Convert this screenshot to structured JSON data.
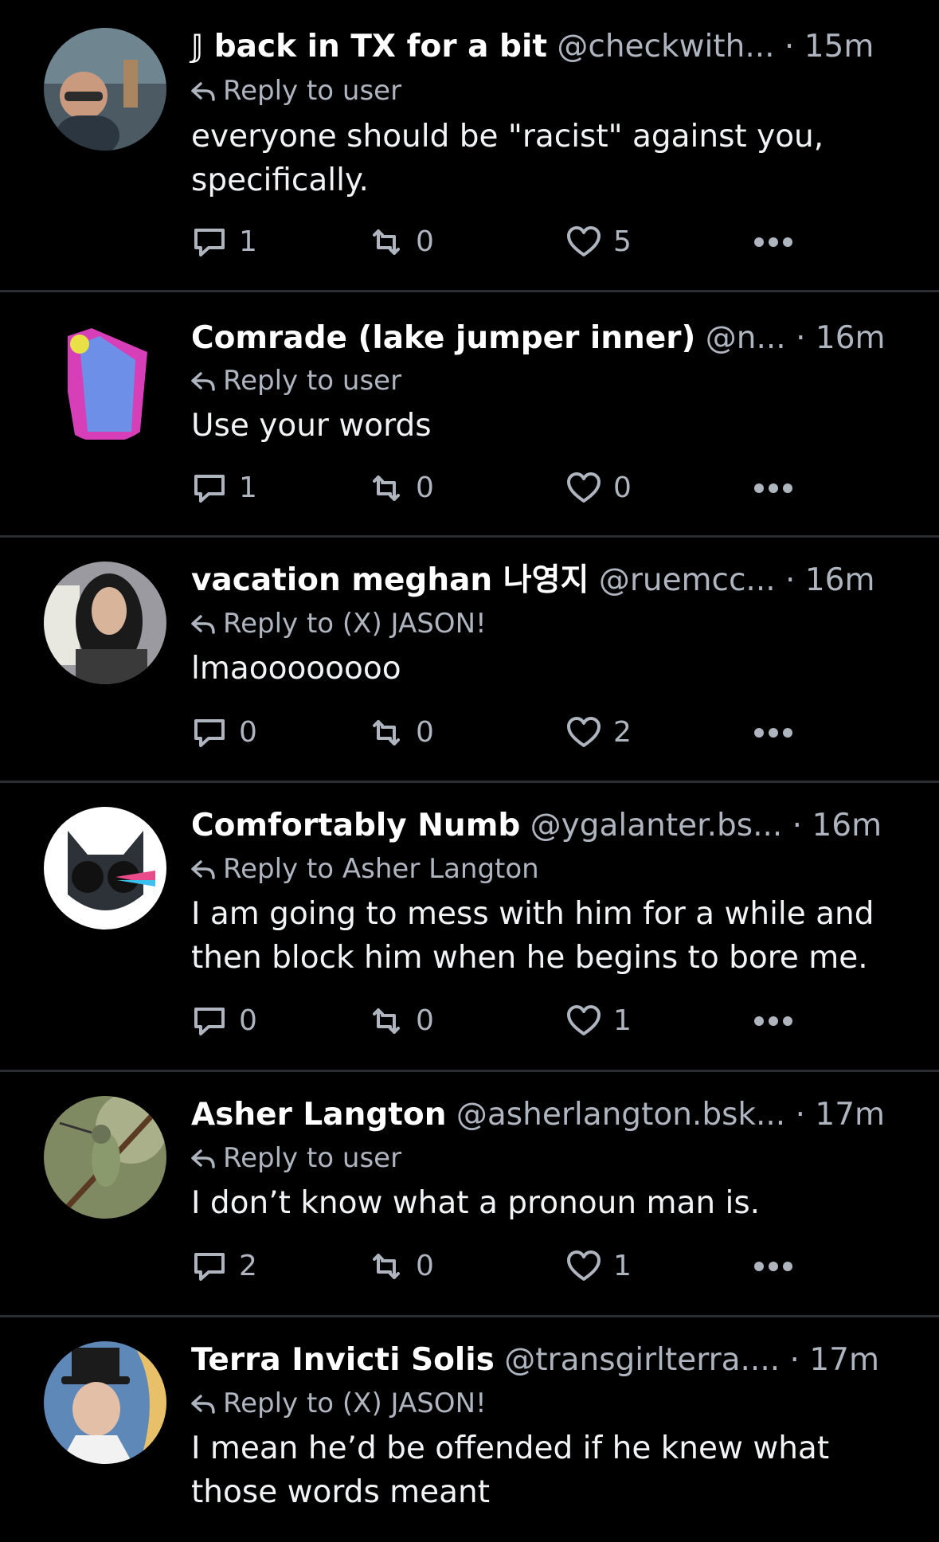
{
  "posts": [
    {
      "name": "𝕁 back in TX for a bit",
      "handle": "@checkwith...",
      "dot": "·",
      "time": "15m",
      "reply_to": "Reply to user",
      "text": "everyone should be \"racist\" against you, specifically.",
      "replies": "1",
      "reposts": "0",
      "likes": "5"
    },
    {
      "name": "Comrade (lake jumper inner)",
      "handle": "@n...",
      "dot": "·",
      "time": "16m",
      "reply_to": "Reply to user",
      "text": "Use your words",
      "replies": "1",
      "reposts": "0",
      "likes": "0"
    },
    {
      "name": "vacation meghan 나영지",
      "handle": "@ruemcc...",
      "dot": "·",
      "time": "16m",
      "reply_to": "Reply to (X) JASON!",
      "text": "lmaoooooooo",
      "replies": "0",
      "reposts": "0",
      "likes": "2"
    },
    {
      "name": "Comfortably Numb",
      "handle": "@ygalanter.bs...",
      "dot": "·",
      "time": "16m",
      "reply_to": "Reply to Asher Langton",
      "text": "I am going to mess with him for a while and then block him when he begins to bore me.",
      "replies": "0",
      "reposts": "0",
      "likes": "1"
    },
    {
      "name": "Asher Langton",
      "handle": "@asherlangton.bsk...",
      "dot": "·",
      "time": "17m",
      "reply_to": "Reply to user",
      "text": "I don’t know what a pronoun man is.",
      "replies": "2",
      "reposts": "0",
      "likes": "1"
    },
    {
      "name": "Terra Invicti Solis",
      "handle": "@transgirlterra....",
      "dot": "·",
      "time": "17m",
      "reply_to": "Reply to (X) JASON!",
      "text": "I mean he’d be offended if he knew what those words meant",
      "replies": "",
      "reposts": "",
      "likes": ""
    }
  ],
  "icons": {
    "reply": "reply-arrow-icon",
    "comment": "speech-bubble-icon",
    "repost": "repost-icon",
    "like": "heart-icon",
    "more": "more-dots-icon"
  },
  "colors": {
    "background": "#000000",
    "text": "#ffffff",
    "muted": "#aeb5bf",
    "separator": "#2a2d31"
  }
}
